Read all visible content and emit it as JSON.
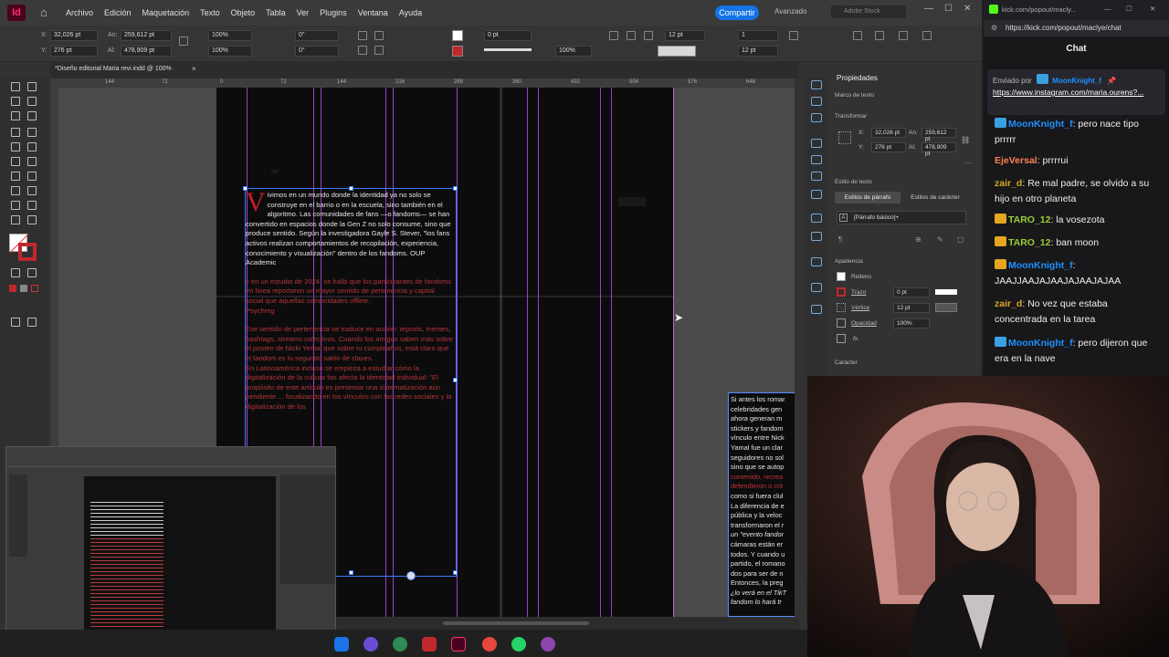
{
  "indesign": {
    "menu": [
      "Archivo",
      "Edición",
      "Maquetación",
      "Texto",
      "Objeto",
      "Tabla",
      "Ver",
      "Plugins",
      "Ventana",
      "Ayuda"
    ],
    "share_label": "Compartir",
    "workspace_label": "Avanzado",
    "stock_placeholder": "Adobe Stock",
    "control": {
      "x": "32,026 pt",
      "y": "276 pt",
      "w": "259,612 pt",
      "h": "478,909 pt",
      "scale_x": "100%",
      "scale_y": "100%",
      "angle": "0°",
      "shear": "0°",
      "stroke": "0 pt",
      "tint": "100%",
      "pt_size": "12 pt",
      "cols": "1",
      "gutter": "12 pt"
    },
    "doc_tab": "*Diseño editorial Maria revi.indd @ 100%",
    "ruler_ticks": [
      "144",
      "72",
      "0",
      "72",
      "144",
      "216",
      "288",
      "360",
      "432",
      "504",
      "576",
      "648"
    ],
    "drop_cap": "V",
    "para1": "ivimos en un mundo donde la identidad ya no solo se construye en el barrio o en la escuela, sino también en el algoritmo. Las comunidades de fans —o fandoms— se han convertido en espacios donde la Gen Z no solo consume, sino que produce sentido. Según la investigadora Gayle S. Stever, \"los fans activos realizan comportamientos de recopilación, experiencia, conocimiento y visualización\" dentro de los fandoms. OUP Academic",
    "para2": "y en un estudio de 2024, se halló que los participantes de fandoms en línea reportaron un mayor sentido de pertenencia y capital social que aquellas comunidades offline.",
    "para2_src": "Psychreg",
    "para3": "Ese sentido de pertenencia se traduce en acción: reposts, memes, hashtags, streams colectivos. Cuando los amigos saben más sobre el posteo de Nicki Yerhal que sobre tu cumpleaños, está claro que el fandom es tu segundo salón de clases.",
    "para4": "En Latinoamérica incluso se empieza a estudiar cómo la digitalización de la cultura fan afecta la identidad individual: \"El propósito de este artículo es presentar una sistematización aún pendiente ... focalizando en los vínculos con las redes sociales y la digitalización de los",
    "right_col_lines": [
      "Si antes los romar",
      "celebridades gen",
      "ahora generan m",
      "stickers y fandom",
      "vínculo entre Nick",
      "Yamal fue un clar",
      "seguidores no sol",
      "sino que se autop",
      "contenido, recrea",
      "defendieron o crit",
      "como si fuera clul",
      "La diferencia de e",
      "pública y la veloc",
      "transformaron el r",
      "un \"evento fandor",
      "cámaras están er",
      "todos. Y cuando u",
      "partido, el romano",
      "dos para ser de n",
      "Entonces, la preg",
      "¿lo verá en el TikT",
      "fandom lo hará tr"
    ],
    "props": {
      "title": "Propiedades",
      "frame_label": "Marco de texto",
      "transform": "Transformar",
      "x": "32,026 pt",
      "y": "276 pt",
      "w": "259,612 pt",
      "h": "478,909 pt",
      "w_label": "An:",
      "h_label": "Al:",
      "text_style": "Estilo de texto",
      "para_styles": "Estilos de párrafo",
      "char_styles": "Estilos de carácter",
      "para_style_value": "[Párrafo básico]+",
      "appearance": "Apariencia",
      "fill": "Relleno",
      "stroke": "Trazo",
      "stroke_val": "0 pt",
      "corners": "Vértice",
      "corner_val": "12 pt",
      "opacity": "Opacidad",
      "opacity_val": "100%",
      "fx": "fx.",
      "character": "Carácter"
    }
  },
  "chat": {
    "url": "https://kick.com/popout/maclye/chat",
    "tab_url": "kick.com/popout/macly...",
    "title": "Chat",
    "pinned_by": "Enviado por",
    "pinned_user": "MoonKnight_f",
    "pinned_link": "https://www.instagram.com/maria.ourens?...",
    "messages": [
      {
        "user": "MoonKnight_f",
        "cls": "u-moon",
        "text": "pero nace tipo prrrrr",
        "badge": "#3aa1e0"
      },
      {
        "user": "EjeVersal",
        "cls": "u-eje",
        "text": "prrrrui",
        "badge": ""
      },
      {
        "user": "zair_d",
        "cls": "u-zair",
        "text": "Re mal padre, se olvido a su hijo en otro planeta",
        "badge": ""
      },
      {
        "user": "TARO_12",
        "cls": "u-taro",
        "text": "la vosezota",
        "badge": "#e5a520"
      },
      {
        "user": "TARO_12",
        "cls": "u-taro",
        "text": "ban moon",
        "badge": "#e5a520"
      },
      {
        "user": "MoonKnight_f",
        "cls": "u-moon",
        "text": "JAAJJAAJAJAAJAJAAJAJAA",
        "badge": "#e5a520"
      },
      {
        "user": "zair_d",
        "cls": "u-zair",
        "text": "No vez que estaba concentrada en la tarea",
        "badge": ""
      },
      {
        "user": "MoonKnight_f",
        "cls": "u-moon",
        "text": "pero dijeron que era en la nave",
        "badge": "#3aa1e0"
      }
    ]
  },
  "colors": {
    "accent": "#1473e6",
    "indesign_pink": "#ff3366",
    "margin_purple": "#9b3fd1",
    "frame_blue": "#3b7cff"
  }
}
